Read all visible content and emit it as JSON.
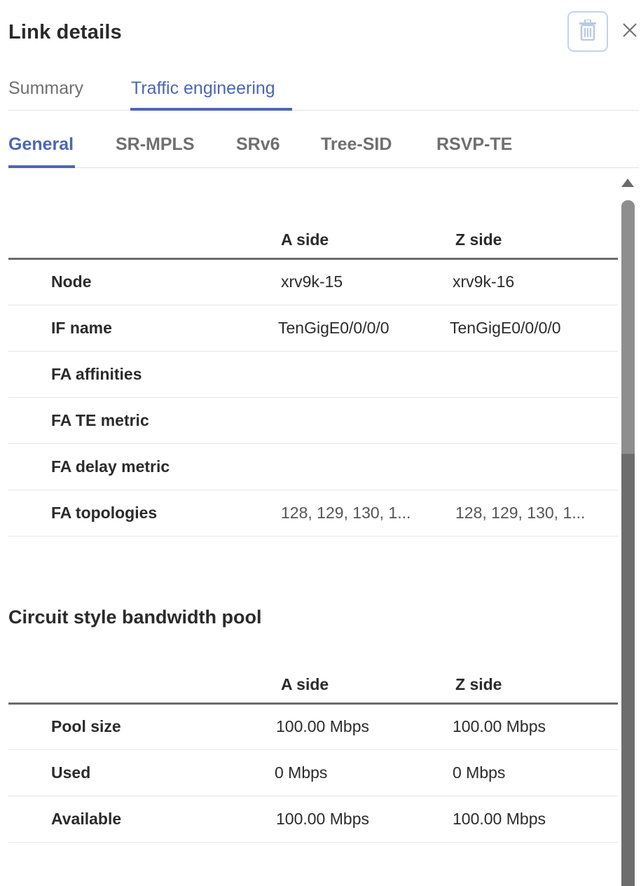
{
  "header": {
    "title": "Link details",
    "delete_icon": "trash-icon",
    "close_icon": "close-icon"
  },
  "tabs_top": [
    {
      "label": "Summary",
      "active": false
    },
    {
      "label": "Traffic engineering",
      "active": true
    }
  ],
  "tabs_sub": [
    {
      "label": "General",
      "active": true
    },
    {
      "label": "SR-MPLS",
      "active": false
    },
    {
      "label": "SRv6",
      "active": false
    },
    {
      "label": "Tree-SID",
      "active": false
    },
    {
      "label": "RSVP-TE",
      "active": false
    }
  ],
  "general_table": {
    "columns": [
      "",
      "A side",
      "Z side"
    ],
    "rows": [
      {
        "label": "Node",
        "a": "xrv9k-15",
        "z": "xrv9k-16"
      },
      {
        "label": "IF name",
        "a": "TenGigE0/0/0/0",
        "z": "TenGigE0/0/0/0"
      },
      {
        "label": "FA affinities",
        "a": "",
        "z": ""
      },
      {
        "label": "FA TE metric",
        "a": "",
        "z": ""
      },
      {
        "label": "FA delay metric",
        "a": "",
        "z": ""
      },
      {
        "label": "FA topologies",
        "a": "128, 129, 130, 1...",
        "z": "128, 129, 130, 1..."
      }
    ]
  },
  "bandwidth_pool": {
    "title": "Circuit style bandwidth pool",
    "columns": [
      "",
      "A side",
      "Z side"
    ],
    "rows": [
      {
        "label": "Pool size",
        "a": "100.00 Mbps",
        "z": "100.00 Mbps"
      },
      {
        "label": "Used",
        "a": "0 Mbps",
        "z": "0 Mbps"
      },
      {
        "label": "Available",
        "a": "100.00 Mbps",
        "z": "100.00 Mbps"
      }
    ]
  },
  "colors": {
    "accent": "#4d66b3",
    "tab_inactive": "#6f6f6f",
    "text": "#2b2b2b",
    "scrollbar": "#6d6d6d"
  }
}
